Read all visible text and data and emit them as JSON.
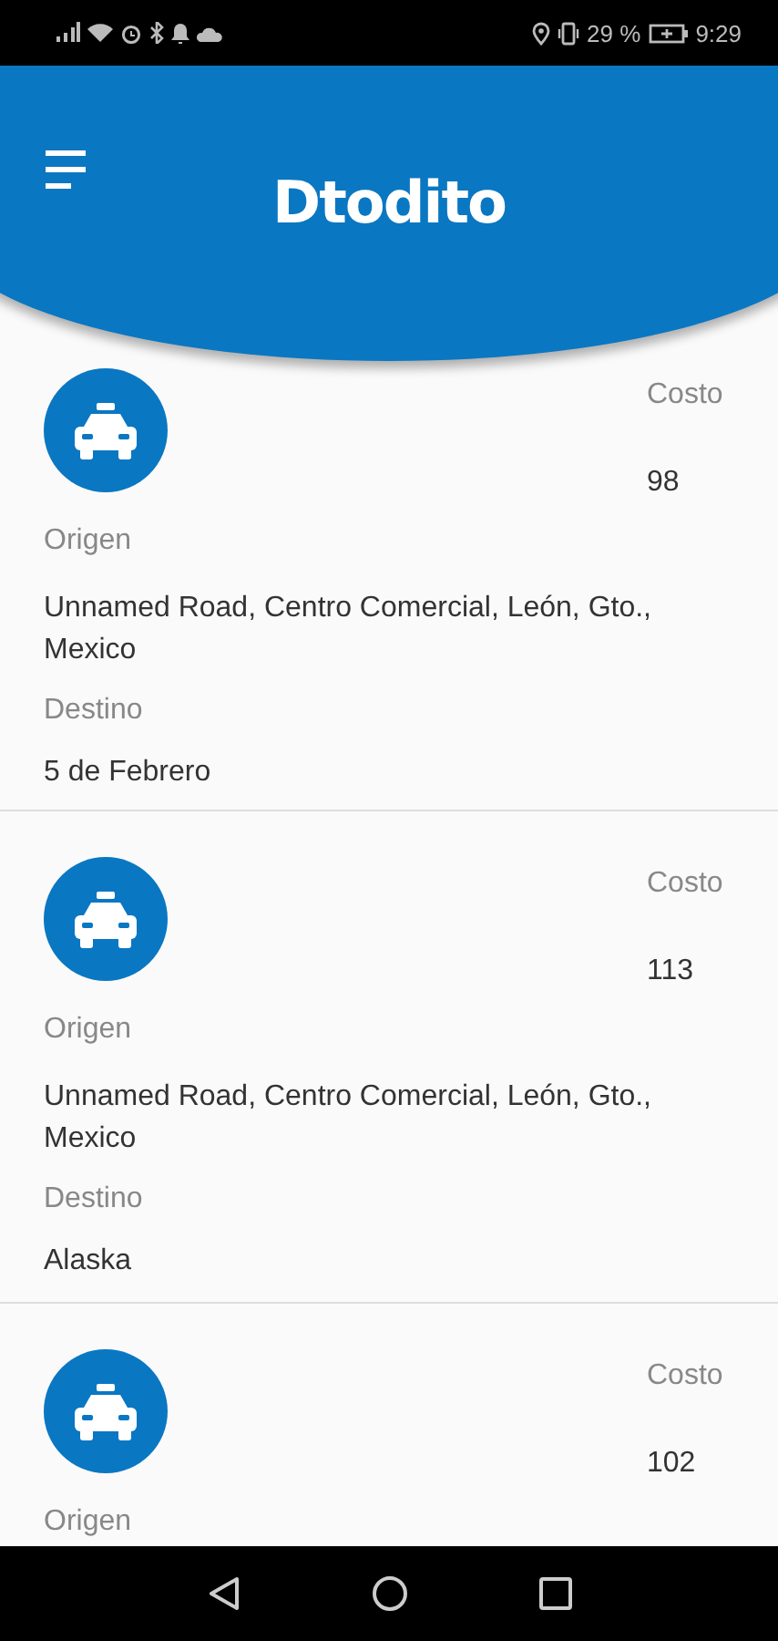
{
  "status_bar": {
    "battery": "29 %",
    "time": "9:29"
  },
  "header": {
    "logo": "Dtodito"
  },
  "trips": [
    {
      "cost_label": "Costo",
      "cost": "98",
      "origin_label": "Origen",
      "origin": "Unnamed Road, Centro Comercial, León, Gto., Mexico",
      "destination_label": "Destino",
      "destination": "5 de Febrero"
    },
    {
      "cost_label": "Costo",
      "cost": "113",
      "origin_label": "Origen",
      "origin": "Unnamed Road, Centro Comercial, León, Gto., Mexico",
      "destination_label": "Destino",
      "destination": "Alaska"
    },
    {
      "cost_label": "Costo",
      "cost": "102",
      "origin_label": "Origen"
    }
  ]
}
